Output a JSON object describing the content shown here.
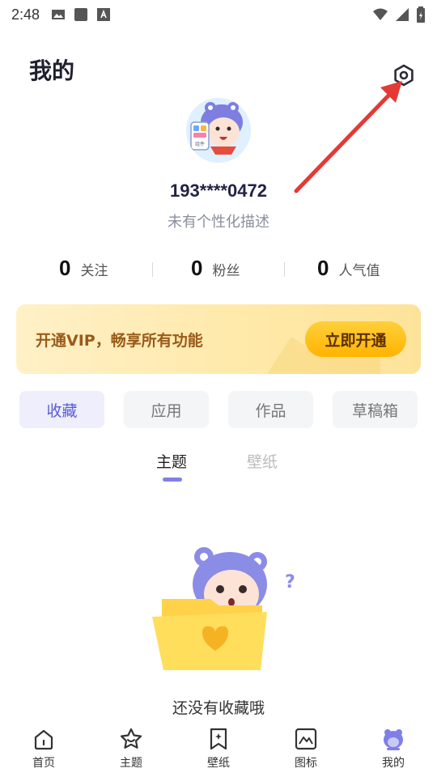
{
  "status_bar": {
    "time": "2:48"
  },
  "header": {
    "title": "我的"
  },
  "profile": {
    "avatar_badge": "组件",
    "username": "193****0472",
    "bio": "未有个性化描述"
  },
  "stats": [
    {
      "num": "0",
      "label": "关注"
    },
    {
      "num": "0",
      "label": "粉丝"
    },
    {
      "num": "0",
      "label": "人气值"
    }
  ],
  "vip": {
    "text": "开通VIP，畅享所有功能",
    "button": "立即开通"
  },
  "category_tabs": [
    {
      "label": "收藏",
      "active": true
    },
    {
      "label": "应用",
      "active": false
    },
    {
      "label": "作品",
      "active": false
    },
    {
      "label": "草稿箱",
      "active": false
    }
  ],
  "sub_tabs": [
    {
      "label": "主题",
      "active": true
    },
    {
      "label": "壁纸",
      "active": false
    }
  ],
  "empty_state": {
    "text": "还没有收藏哦"
  },
  "bottom_nav": [
    {
      "label": "首页",
      "icon": "home-icon"
    },
    {
      "label": "主题",
      "icon": "theme-icon"
    },
    {
      "label": "壁纸",
      "icon": "wallpaper-icon"
    },
    {
      "label": "图标",
      "icon": "icon-gallery-icon"
    },
    {
      "label": "我的",
      "icon": "profile-icon",
      "active": true
    }
  ],
  "colors": {
    "accent": "#7f7fe8",
    "vip_button": "#ffc21a",
    "annotation_arrow": "#e53935"
  }
}
